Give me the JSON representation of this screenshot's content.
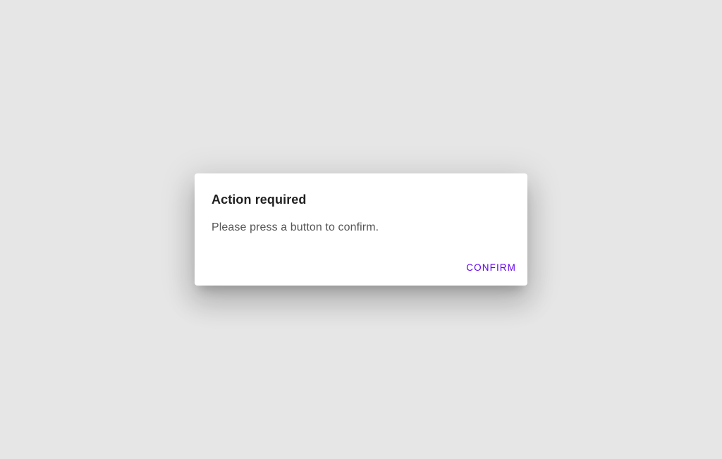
{
  "dialog": {
    "title": "Action required",
    "content": "Please press a button to confirm.",
    "actions": {
      "confirm_label": "CONFIRM"
    }
  },
  "colors": {
    "background": "#e6e6e6",
    "surface": "#ffffff",
    "title_text": "#212121",
    "body_text": "#555555",
    "primary": "#6200ee"
  }
}
